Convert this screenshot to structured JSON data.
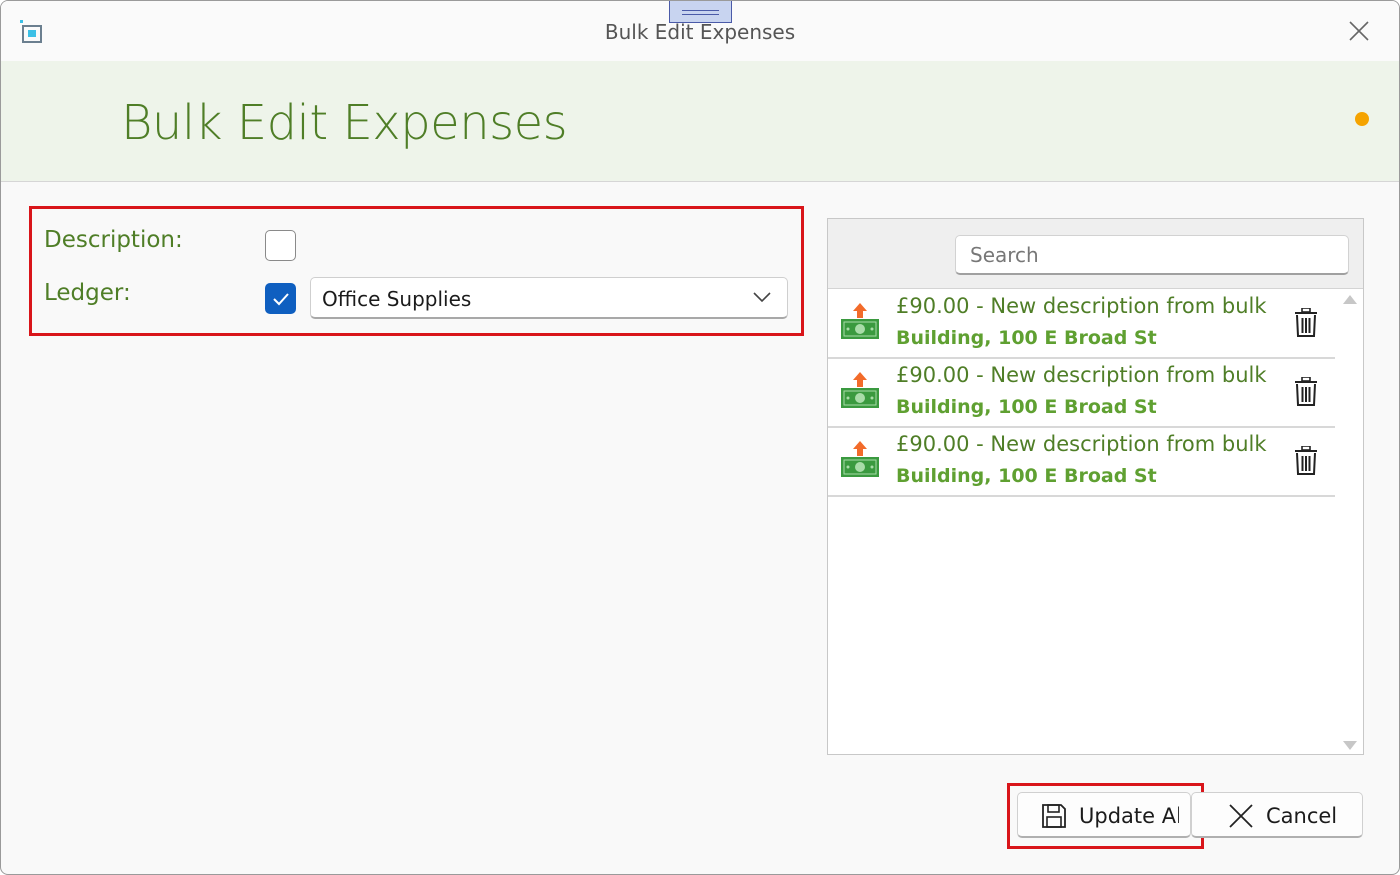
{
  "window": {
    "title": "Bulk Edit Expenses"
  },
  "header": {
    "title": "Bulk Edit Expenses",
    "status_color": "#f5a300"
  },
  "fields": {
    "description_label": "Description:",
    "description_checked": false,
    "ledger_label": "Ledger:",
    "ledger_checked": true,
    "ledger_value": "Office Supplies"
  },
  "search": {
    "placeholder": "Search",
    "value": ""
  },
  "expenses": [
    {
      "line1": "£90.00 - New description from bulk",
      "line2": "Building, 100 E Broad St",
      "icon": "money-icon",
      "action_icon": "trash-icon"
    },
    {
      "line1": "£90.00 - New description from bulk",
      "line2": "Building, 100 E Broad St",
      "icon": "money-icon",
      "action_icon": "trash-icon"
    },
    {
      "line1": "£90.00 - New description from bulk",
      "line2": "Building, 100 E Broad St",
      "icon": "money-icon",
      "action_icon": "trash-icon"
    }
  ],
  "buttons": {
    "update_label": "Update Al",
    "update_icon": "save-icon",
    "cancel_label": "Cancel",
    "cancel_icon": "close-icon"
  },
  "colors": {
    "accent_green": "#4f7e27",
    "header_bg": "#eef4ea",
    "highlight_red": "#d9151a",
    "checkbox_blue": "#0f5fc0"
  }
}
